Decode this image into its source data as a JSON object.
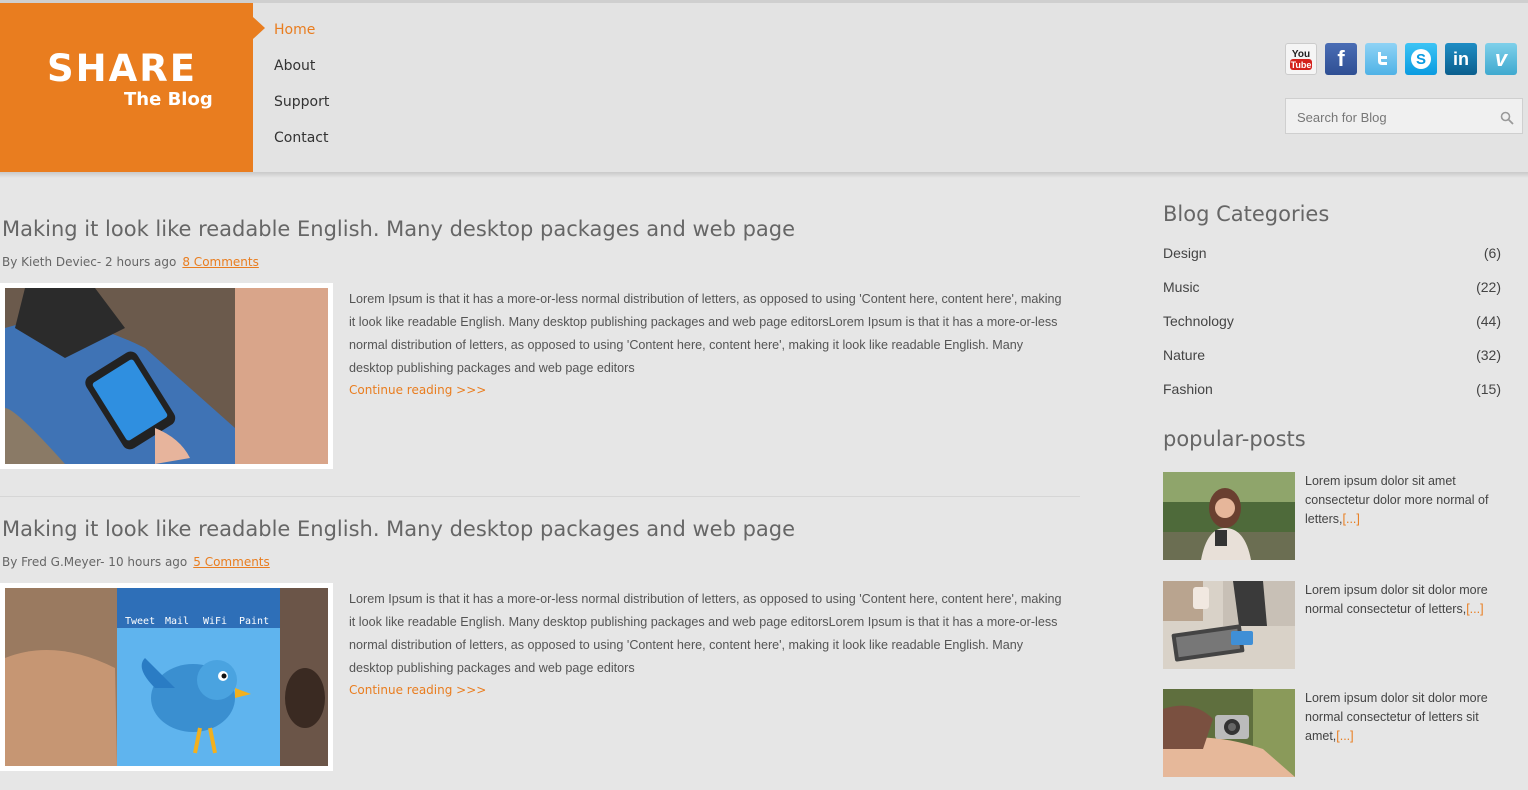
{
  "brand": {
    "name": "SHARE",
    "tagline": "The Blog",
    "accent": "#e97d1f"
  },
  "nav": [
    "Home",
    "About",
    "Support",
    "Contact"
  ],
  "social": [
    {
      "icon": "youtube-icon",
      "label": "You Tube",
      "color": "#c4302b"
    },
    {
      "icon": "facebook-icon",
      "label": "f",
      "color": "#3b5998"
    },
    {
      "icon": "twitter-icon",
      "label": "t",
      "color": "#55acee"
    },
    {
      "icon": "skype-icon",
      "label": "S",
      "color": "#00aff0"
    },
    {
      "icon": "linkedin-icon",
      "label": "in",
      "color": "#0e76a8"
    },
    {
      "icon": "vimeo-icon",
      "label": "v",
      "color": "#4fb5d8"
    }
  ],
  "search": {
    "placeholder": "Search for Blog"
  },
  "posts": [
    {
      "title": "Making it look like readable English. Many desktop packages and web page",
      "author_time": "By Kieth Deviec- 2 hours ago",
      "comments": "8 Comments",
      "excerpt": "Lorem Ipsum is that it has a more-or-less normal distribution of letters, as opposed to using 'Content here, content here', making it look like readable English. Many desktop publishing packages and web page editorsLorem Ipsum is that it has a more-or-less normal distribution of letters, as opposed to using 'Content here, content here', making it look like readable English. Many desktop publishing packages and web page editors",
      "continue": "Continue reading >>>"
    },
    {
      "title": "Making it look like readable English. Many desktop packages and web page",
      "author_time": "By Fred G.Meyer- 10 hours ago",
      "comments": "5 Comments",
      "excerpt": "Lorem Ipsum is that it has a more-or-less normal distribution of letters, as opposed to using 'Content here, content here', making it look like readable English. Many desktop publishing packages and web page editorsLorem Ipsum is that it has a more-or-less normal distribution of letters, as opposed to using 'Content here, content here', making it look like readable English. Many desktop publishing packages and web page editors",
      "continue": "Continue reading >>>",
      "image_labels": [
        "Tweet",
        "Mail",
        "WiFi",
        "Paint"
      ]
    }
  ],
  "sidebar": {
    "categories_title": "Blog Categories",
    "categories": [
      {
        "name": "Design",
        "count": "(6)"
      },
      {
        "name": "Music",
        "count": "(22)"
      },
      {
        "name": "Technology",
        "count": "(44)"
      },
      {
        "name": "Nature",
        "count": "(32)"
      },
      {
        "name": "Fashion",
        "count": "(15)"
      }
    ],
    "popular_title": "popular-posts",
    "popular": [
      {
        "text": "Lorem ipsum dolor sit amet consectetur dolor more normal of letters,",
        "more": "[...]"
      },
      {
        "text": "Lorem ipsum dolor sit dolor more normal consectetur of letters,",
        "more": "[...]"
      },
      {
        "text": "Lorem ipsum dolor sit dolor more normal consectetur of letters sit amet,",
        "more": "[...]"
      }
    ]
  }
}
